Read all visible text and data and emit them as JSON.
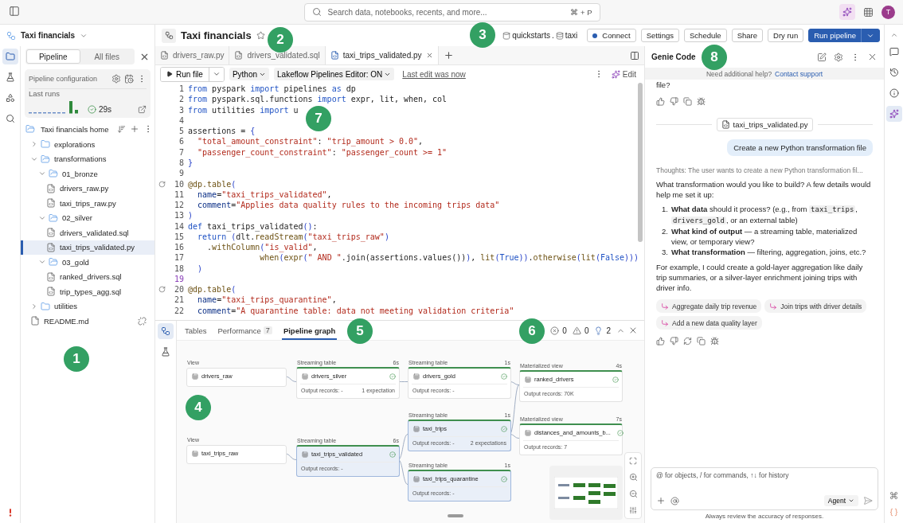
{
  "top_bar": {
    "search": {
      "placeholder": "Search data, notebooks, recents, and more...",
      "shortcut": "⌘ + P"
    },
    "avatar": "T"
  },
  "left_rail": [
    {
      "kind": "folder",
      "selected": true
    },
    {
      "kind": "flask",
      "selected": false
    },
    {
      "kind": "shapes",
      "selected": false
    },
    {
      "kind": "search",
      "selected": false
    }
  ],
  "pipeline_header": {
    "title": "Taxi financials"
  },
  "left_panel": {
    "tabs": [
      {
        "label": "Pipeline",
        "selected": true
      },
      {
        "label": "All files",
        "selected": false
      }
    ],
    "config": {
      "title": "Pipeline configuration",
      "last_runs": "Last runs",
      "succeeded": true,
      "duration": "29s"
    },
    "tree": {
      "root": "Taxi financials home",
      "items": [
        {
          "label": "explorations",
          "kind": "folder",
          "expanded": false,
          "selected": false
        },
        {
          "label": "transformations",
          "kind": "source_folder",
          "expanded": true,
          "selected": false,
          "children": [
            {
              "label": "01_bronze",
              "kind": "source_folder",
              "expanded": true,
              "selected": false,
              "children": [
                {
                  "label": "drivers_raw.py",
                  "kind": "file",
                  "selected": false
                },
                {
                  "label": "taxi_trips_raw.py",
                  "kind": "file",
                  "selected": false
                }
              ]
            },
            {
              "label": "02_silver",
              "kind": "source_folder",
              "expanded": true,
              "selected": false,
              "children": [
                {
                  "label": "drivers_validated.sql",
                  "kind": "file",
                  "selected": false
                },
                {
                  "label": "taxi_trips_validated.py",
                  "kind": "file",
                  "selected": true
                }
              ]
            },
            {
              "label": "03_gold",
              "kind": "source_folder",
              "expanded": true,
              "selected": false,
              "children": [
                {
                  "label": "ranked_drivers.sql",
                  "kind": "file",
                  "selected": false
                },
                {
                  "label": "trip_types_agg.sql",
                  "kind": "file",
                  "selected": false
                }
              ]
            }
          ]
        },
        {
          "label": "utilities",
          "kind": "folder",
          "expanded": false,
          "selected": false
        },
        {
          "label": "README.md",
          "kind": "document",
          "selected": false
        }
      ]
    }
  },
  "main_header": {
    "title": "Taxi financials",
    "catalog": "quickstarts",
    "separator": ".",
    "schema": "taxi",
    "buttons": [
      {
        "label": "Connect",
        "kind": "connect"
      },
      {
        "label": "Settings",
        "kind": "plain"
      },
      {
        "label": "Schedule",
        "kind": "plain"
      },
      {
        "label": "Share",
        "kind": "plain"
      },
      {
        "label": "Dry run",
        "kind": "plain"
      },
      {
        "label": "Run pipeline",
        "kind": "primary"
      }
    ]
  },
  "editor": {
    "tabs": [
      {
        "label": "drivers_raw.py",
        "selected": false
      },
      {
        "label": "drivers_validated.sql",
        "selected": false
      },
      {
        "label": "taxi_trips_validated.py",
        "selected": true
      }
    ],
    "toolbar": {
      "run": "Run file",
      "language": "Python",
      "mode": "Lakeflow Pipelines Editor: ON",
      "last_edit": "Last edit was now",
      "edit": "Edit"
    },
    "lines": [
      {
        "n": "1",
        "marker": false,
        "current": false,
        "tokens": [
          {
            "kind": "keyword",
            "text": "from"
          },
          {
            "kind": "plain",
            "text": " pyspark "
          },
          {
            "kind": "keyword",
            "text": "import"
          },
          {
            "kind": "plain",
            "text": " pipelines "
          },
          {
            "kind": "keyword",
            "text": "as"
          },
          {
            "kind": "plain",
            "text": " dp"
          }
        ]
      },
      {
        "n": "2",
        "marker": false,
        "current": false,
        "tokens": [
          {
            "kind": "keyword",
            "text": "from"
          },
          {
            "kind": "plain",
            "text": " pyspark.sql.functions "
          },
          {
            "kind": "keyword",
            "text": "import"
          },
          {
            "kind": "plain",
            "text": " expr, lit, when, col"
          }
        ]
      },
      {
        "n": "3",
        "marker": false,
        "current": false,
        "tokens": [
          {
            "kind": "keyword",
            "text": "from"
          },
          {
            "kind": "plain",
            "text": " utilities "
          },
          {
            "kind": "keyword",
            "text": "import"
          },
          {
            "kind": "plain",
            "text": " u"
          }
        ]
      },
      {
        "n": "4",
        "marker": false,
        "current": false
      },
      {
        "n": "5",
        "marker": false,
        "current": false,
        "tokens": [
          {
            "kind": "plain",
            "text": "assertions = "
          },
          {
            "kind": "bracket",
            "text": "{"
          }
        ]
      },
      {
        "n": "6",
        "marker": false,
        "current": false,
        "tokens": [
          {
            "kind": "string",
            "text": "  \"total_amount_constraint\""
          },
          {
            "kind": "plain",
            "text": ": "
          },
          {
            "kind": "string",
            "text": "\"trip_amount > 0.0\""
          },
          {
            "kind": "plain",
            "text": ","
          }
        ]
      },
      {
        "n": "7",
        "marker": false,
        "current": false,
        "tokens": [
          {
            "kind": "string",
            "text": "  \"passenger_count_constraint\""
          },
          {
            "kind": "plain",
            "text": ": "
          },
          {
            "kind": "string",
            "text": "\"passenger_count >= 1\""
          }
        ]
      },
      {
        "n": "8",
        "marker": false,
        "current": false,
        "tokens": [
          {
            "kind": "bracket",
            "text": "}"
          }
        ]
      },
      {
        "n": "9",
        "marker": false,
        "current": false
      },
      {
        "n": "10",
        "marker": true,
        "current": false,
        "tokens": [
          {
            "kind": "function",
            "text": "@dp.table"
          },
          {
            "kind": "bracket",
            "text": "("
          }
        ]
      },
      {
        "n": "11",
        "marker": false,
        "current": false,
        "tokens": [
          {
            "kind": "param",
            "text": "  name"
          },
          {
            "kind": "plain",
            "text": "="
          },
          {
            "kind": "string",
            "text": "\"taxi_trips_validated\""
          },
          {
            "kind": "plain",
            "text": ","
          }
        ]
      },
      {
        "n": "12",
        "marker": false,
        "current": false,
        "tokens": [
          {
            "kind": "param",
            "text": "  comment"
          },
          {
            "kind": "plain",
            "text": "="
          },
          {
            "kind": "string",
            "text": "\"Applies data quality rules to the incoming trips data\""
          }
        ]
      },
      {
        "n": "13",
        "marker": false,
        "current": false,
        "tokens": [
          {
            "kind": "bracket",
            "text": ")"
          }
        ]
      },
      {
        "n": "14",
        "marker": false,
        "current": false,
        "tokens": [
          {
            "kind": "keyword",
            "text": "def"
          },
          {
            "kind": "plain",
            "text": " taxi_trips_validated"
          },
          {
            "kind": "bracket",
            "text": "()"
          },
          {
            "kind": "plain",
            "text": ":"
          }
        ]
      },
      {
        "n": "15",
        "marker": false,
        "current": false,
        "tokens": [
          {
            "kind": "keyword",
            "text": "  return"
          },
          {
            "kind": "bracket",
            "text": " ("
          },
          {
            "kind": "plain",
            "text": "dlt."
          },
          {
            "kind": "function",
            "text": "readStream"
          },
          {
            "kind": "bracket",
            "text": "("
          },
          {
            "kind": "string",
            "text": "\"taxi_trips_raw\""
          },
          {
            "kind": "bracket",
            "text": ")"
          }
        ]
      },
      {
        "n": "16",
        "marker": false,
        "current": false,
        "tokens": [
          {
            "kind": "plain",
            "text": "    ."
          },
          {
            "kind": "function",
            "text": "withColumn"
          },
          {
            "kind": "bracket",
            "text": "("
          },
          {
            "kind": "string",
            "text": "\"is_valid\""
          },
          {
            "kind": "plain",
            "text": ","
          }
        ]
      },
      {
        "n": "17",
        "marker": false,
        "current": false,
        "tokens": [
          {
            "kind": "function",
            "text": "               when"
          },
          {
            "kind": "bracket",
            "text": "("
          },
          {
            "kind": "function",
            "text": "expr"
          },
          {
            "kind": "bracket",
            "text": "("
          },
          {
            "kind": "string",
            "text": "\" AND \""
          },
          {
            "kind": "plain",
            "text": ".join(assertions.values())"
          },
          {
            "kind": "bracket",
            "text": ")"
          },
          {
            "kind": "plain",
            "text": ", "
          },
          {
            "kind": "function",
            "text": "lit"
          },
          {
            "kind": "bracket",
            "text": "("
          },
          {
            "kind": "keyword",
            "text": "True"
          },
          {
            "kind": "bracket",
            "text": "))"
          },
          {
            "kind": "plain",
            "text": "."
          },
          {
            "kind": "function",
            "text": "otherwise"
          },
          {
            "kind": "bracket",
            "text": "("
          },
          {
            "kind": "function",
            "text": "lit"
          },
          {
            "kind": "bracket",
            "text": "("
          },
          {
            "kind": "keyword",
            "text": "False"
          },
          {
            "kind": "bracket",
            "text": ")))"
          }
        ]
      },
      {
        "n": "18",
        "marker": false,
        "current": false,
        "tokens": [
          {
            "kind": "bracket",
            "text": "  )"
          }
        ]
      },
      {
        "n": "19",
        "marker": false,
        "current": true
      },
      {
        "n": "20",
        "marker": true,
        "current": false,
        "tokens": [
          {
            "kind": "function",
            "text": "@dp.table"
          },
          {
            "kind": "bracket",
            "text": "("
          }
        ]
      },
      {
        "n": "21",
        "marker": false,
        "current": false,
        "tokens": [
          {
            "kind": "param",
            "text": "  name"
          },
          {
            "kind": "plain",
            "text": "="
          },
          {
            "kind": "string",
            "text": "\"taxi_trips_quarantine\""
          },
          {
            "kind": "plain",
            "text": ","
          }
        ]
      },
      {
        "n": "22",
        "marker": false,
        "current": false,
        "tokens": [
          {
            "kind": "param",
            "text": "  comment"
          },
          {
            "kind": "plain",
            "text": "="
          },
          {
            "kind": "string",
            "text": "\"A quarantine table: data not meeting validation criteria\""
          }
        ]
      }
    ]
  },
  "bottom_panel": {
    "tabs": [
      {
        "label": "Tables",
        "selected": false
      },
      {
        "label": "Performance",
        "badge": "7",
        "selected": false
      },
      {
        "label": "Pipeline graph",
        "selected": true
      }
    ],
    "errors": "0",
    "warnings": "0",
    "suggestions": "2",
    "graph": {
      "nodes": [
        {
          "kind": "view",
          "type": "View",
          "name": "drivers_raw",
          "highlighted": false
        },
        {
          "kind": "table",
          "type": "Streaming table",
          "duration": "6s",
          "name": "drivers_silver",
          "succeeded": true,
          "records": "Output records: -",
          "expectations": "1 expectation",
          "highlighted": false
        },
        {
          "kind": "table",
          "type": "Streaming table",
          "duration": "1s",
          "name": "drivers_gold",
          "succeeded": true,
          "records": "Output records: -",
          "highlighted": false
        },
        {
          "kind": "table",
          "type": "Materialized view",
          "duration": "4s",
          "name": "ranked_drivers",
          "succeeded": true,
          "records": "Output records: 70K",
          "highlighted": false
        },
        {
          "kind": "table",
          "type": "Streaming table",
          "duration": "1s",
          "name": "taxi_trips",
          "succeeded": true,
          "records": "Output records: -",
          "expectations": "2 expectations",
          "highlighted": true
        },
        {
          "kind": "table",
          "type": "Materialized view",
          "duration": "7s",
          "name": "distances_and_amounts_b...",
          "succeeded": true,
          "records": "Output records: 7",
          "highlighted": false
        },
        {
          "kind": "view",
          "type": "View",
          "name": "taxi_trips_raw",
          "highlighted": false
        },
        {
          "kind": "table",
          "type": "Streaming table",
          "duration": "6s",
          "name": "taxi_trips_validated",
          "succeeded": true,
          "records": "Output records: -",
          "highlighted": true
        },
        {
          "kind": "table",
          "type": "Streaming table",
          "duration": "1s",
          "name": "taxi_trips_quarantine",
          "succeeded": true,
          "records": "Output records: -",
          "highlighted": true
        }
      ]
    }
  },
  "genie": {
    "title": "Genie Code",
    "help": "Need additional help?",
    "help_link": "Contact support",
    "cut_text": "file?",
    "file_chip": "taxi_trips_validated.py",
    "user_message": "Create a new Python transformation file",
    "thoughts": "Thoughts: The user wants to create a new Python transformation fil...",
    "intro": "What transformation would you like to build? A few details would help me set it up:",
    "questions": [
      {
        "num": "1.",
        "parts": [
          {
            "kind": "bold",
            "text": "What data"
          },
          {
            "kind": "plain",
            "text": " should it process? (e.g., from "
          },
          {
            "kind": "code",
            "text": "taxi_trips"
          },
          {
            "kind": "plain",
            "text": ", "
          },
          {
            "kind": "code",
            "text": "drivers_gold"
          },
          {
            "kind": "plain",
            "text": ", or an external table)"
          }
        ]
      },
      {
        "num": "2.",
        "parts": [
          {
            "kind": "bold",
            "text": "What kind of output"
          },
          {
            "kind": "plain",
            "text": " — a streaming table, materialized view, or temporary view?"
          }
        ]
      },
      {
        "num": "3.",
        "parts": [
          {
            "kind": "bold",
            "text": "What transformation"
          },
          {
            "kind": "plain",
            "text": " — filtering, aggregation, joins, etc.?"
          }
        ]
      }
    ],
    "outro": "For example, I could create a gold-layer aggregation like daily trip summaries, or a silver-layer enrichment joining trips with driver info.",
    "suggestions": [
      "Aggregate daily trip revenue",
      "Join trips with driver details",
      "Add a new data quality layer"
    ],
    "input": {
      "placeholder": "@ for objects, / for commands, ↑↓ for history",
      "mode": "Agent"
    },
    "footer": "Always review the accuracy of responses."
  },
  "right_rail": [
    {
      "kind": "comment",
      "selected": false
    },
    {
      "kind": "history",
      "selected": false
    },
    {
      "kind": "info",
      "selected": false
    },
    {
      "kind": "assistant",
      "selected": true
    }
  ],
  "callouts": [
    "1",
    "2",
    "3",
    "4",
    "5",
    "6",
    "7",
    "8"
  ]
}
